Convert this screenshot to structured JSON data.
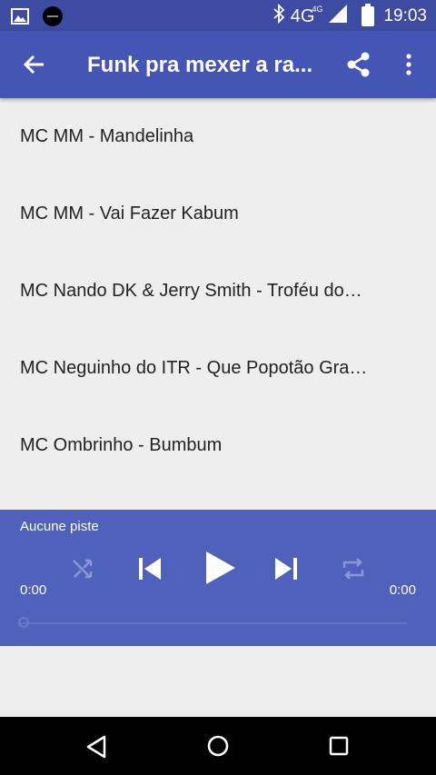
{
  "status_bar": {
    "time": "19:03",
    "network": "4G",
    "network_small": "4G",
    "icons": [
      "image-icon",
      "app-logo-icon",
      "bluetooth-icon",
      "signal-icon",
      "battery-icon"
    ]
  },
  "app_bar": {
    "title": "Funk pra mexer a ra...",
    "icons": [
      "back-arrow-icon",
      "share-icon",
      "more-vert-icon"
    ]
  },
  "tracks": [
    "MC MM - Mandelinha",
    "MC MM - Vai Fazer Kabum",
    "MC Nando DK & Jerry Smith - Troféu do…",
    "MC Neguinho do ITR - Que Popotão Gra…",
    "MC Ombrinho - Bumbum"
  ],
  "player": {
    "now_playing": "Aucune piste",
    "elapsed": "0:00",
    "duration": "0:00",
    "progress": 0,
    "shuffle_enabled": false,
    "repeat_enabled": false
  },
  "colors": {
    "status_bar": "#3d4ba3",
    "app_bar": "#4555b6",
    "player": "#5061bc",
    "list_background": "#eeeeee",
    "nav_bar": "#000000"
  }
}
